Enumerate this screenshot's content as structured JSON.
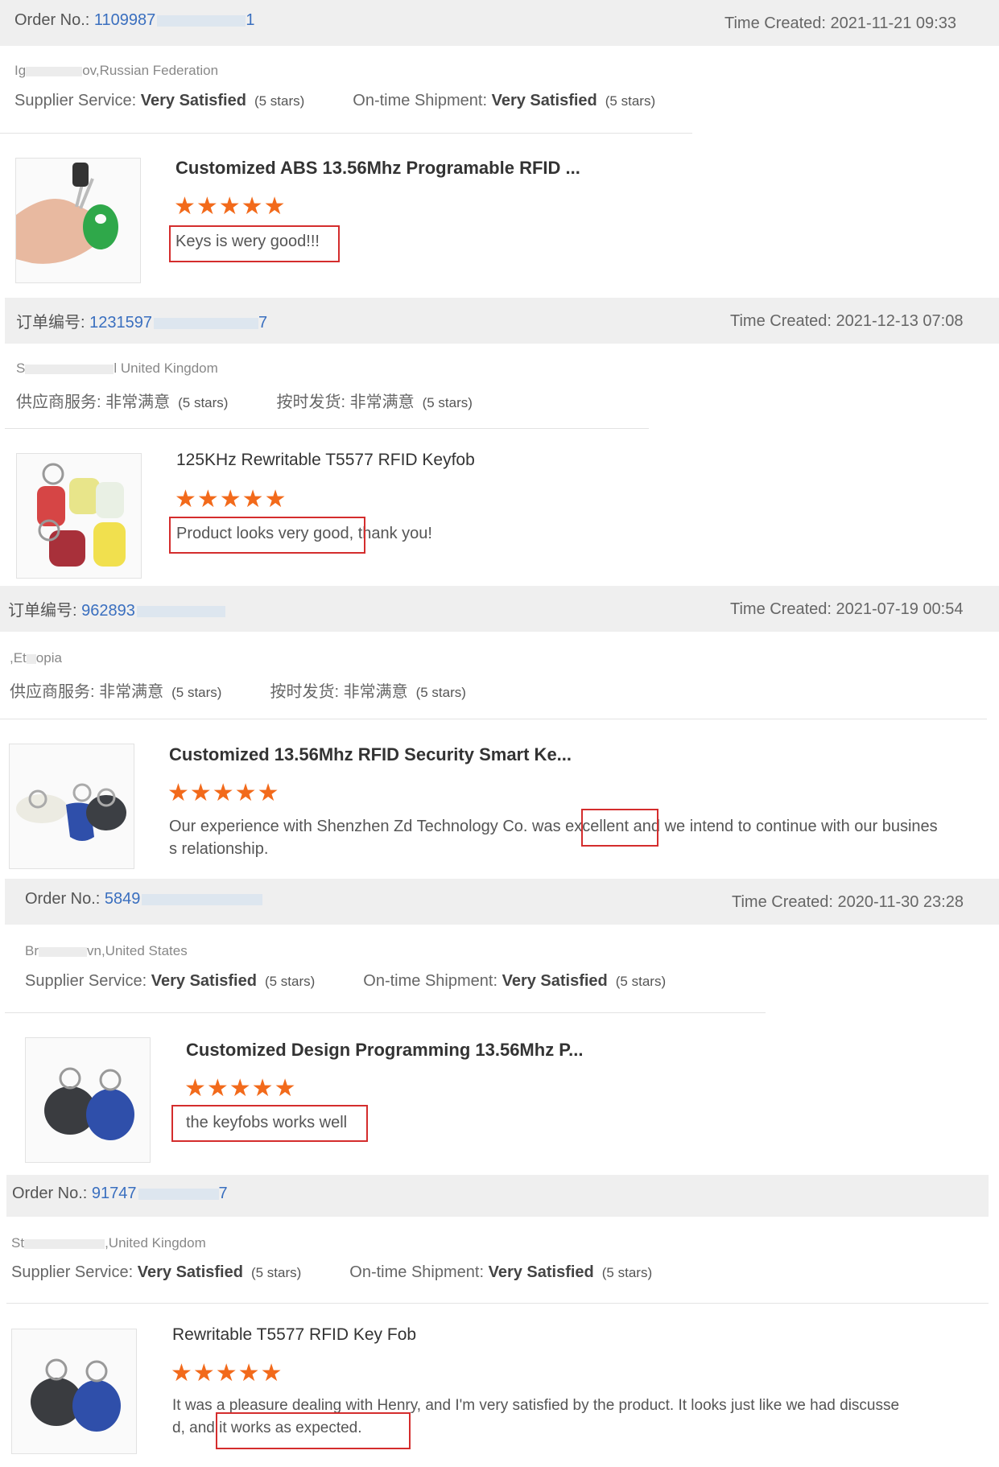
{
  "reviews": [
    {
      "order_label": "Order No.:",
      "order_no": "1109987",
      "order_tail": "1",
      "time_label": "Time Created:",
      "time": "2021-11-21 09:33",
      "location": "Ig",
      "location_tail": "ov,Russian Federation",
      "service_label": "Supplier Service:",
      "service_value": "Very Satisfied",
      "service_stars": "(5 stars)",
      "shipment_label": "On-time Shipment:",
      "shipment_value": "Very Satisfied",
      "shipment_stars": "(5 stars)",
      "product_title": "Customized ABS 13.56Mhz Programable RFID ...",
      "rating": "★★★★★",
      "comment": "Keys is wery good!!!",
      "highlight": "Keys is wery good!!!"
    },
    {
      "order_label": "订单编号:",
      "order_no": "1231597",
      "order_tail": "7",
      "time_label": "Time Created:",
      "time": "2021-12-13 07:08",
      "location": "S",
      "location_tail": "l United Kingdom",
      "service_label": "供应商服务:",
      "service_value": "非常满意",
      "service_stars": "(5 stars)",
      "shipment_label": "按时发货:",
      "shipment_value": "非常满意",
      "shipment_stars": "(5 stars)",
      "product_title": "125KHz Rewritable T5577 RFID Keyfob",
      "rating": "★★★★★",
      "comment_hl": "Product looks very good",
      "comment_rest": "thank you!"
    },
    {
      "order_label": "订单编号:",
      "order_no": "962893",
      "time_label": "Time Created:",
      "time": "2021-07-19 00:54",
      "location": ",Et",
      "location_tail": "opia",
      "service_label": "供应商服务:",
      "service_value": "非常满意",
      "service_stars": "(5 stars)",
      "shipment_label": "按时发货:",
      "shipment_value": "非常满意",
      "shipment_stars": "(5 stars)",
      "product_title": "Customized 13.56Mhz RFID Security Smart Ke...",
      "rating": "★★★★★",
      "comment_a": "Our experience with Shenzhen Zd Technology Co. was",
      "comment_hl": "excellent",
      "comment_b": "and we intend to continue with our busines",
      "comment_c": "s relationship."
    },
    {
      "order_label": "Order No.:",
      "order_no": "5849",
      "time_label": "Time Created:",
      "time": "2020-11-30 23:28",
      "location": "Br",
      "location_tail": "vn,United States",
      "service_label": "Supplier Service:",
      "service_value": "Very Satisfied",
      "service_stars": "(5 stars)",
      "shipment_label": "On-time Shipment:",
      "shipment_value": "Very Satisfied",
      "shipment_stars": "(5 stars)",
      "product_title": "Customized Design Programming 13.56Mhz P...",
      "rating": "★★★★★",
      "comment": "the keyfobs works well"
    },
    {
      "order_label": "Order No.:",
      "order_no": "91747",
      "order_tail": "7",
      "location": "St",
      "location_tail": ",United Kingdom",
      "service_label": "Supplier Service:",
      "service_value": "Very Satisfied",
      "service_stars": "(5 stars)",
      "shipment_label": "On-time Shipment:",
      "shipment_value": "Very Satisfied",
      "shipment_stars": "(5 stars)",
      "product_title": "Rewritable T5577 RFID Key Fob",
      "rating": "★★★★★",
      "comment_a": "It was a pleasure dealing with Henry, and I'm very satisfied by the product. It looks just like we had discusse",
      "comment_b": "d, and",
      "comment_hl": "it works as expected."
    }
  ],
  "colors": {
    "accent": "#3a6fbf",
    "star": "#f26a1b",
    "highlight": "#d42d2d",
    "header_bg": "#efefef"
  }
}
